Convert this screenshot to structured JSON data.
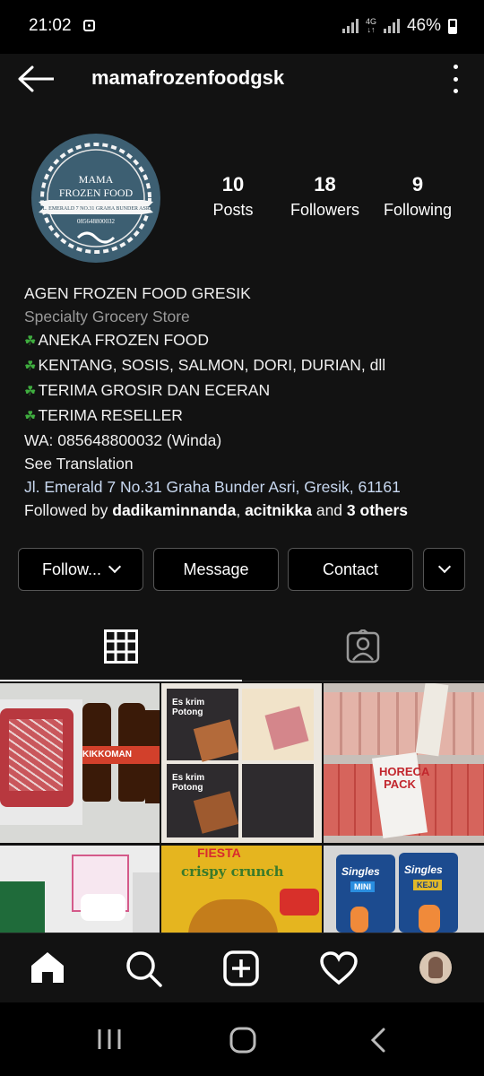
{
  "status": {
    "time": "21:02",
    "network": "4G",
    "battery": "46%"
  },
  "header": {
    "username": "mamafrozenfoodgsk"
  },
  "avatar": {
    "line1": "MAMA",
    "line2": "FROZEN FOOD",
    "ribbon": "JL. EMERALD 7 NO.31 GRAHA BUNDER ASRI",
    "phone": "085648800032"
  },
  "stats": [
    {
      "value": "10",
      "label": "Posts"
    },
    {
      "value": "18",
      "label": "Followers"
    },
    {
      "value": "9",
      "label": "Following"
    }
  ],
  "bio": {
    "name": "AGEN FROZEN FOOD GRESIK",
    "category": "Specialty Grocery Store",
    "lines": [
      "ANEKA FROZEN FOOD",
      "KENTANG, SOSIS, SALMON, DORI, DURIAN, dll",
      "TERIMA GROSIR DAN ECERAN",
      "TERIMA RESELLER"
    ],
    "contact": "WA: 085648800032 (Winda)",
    "translate": "See Translation",
    "address": "Jl. Emerald 7 No.31 Graha Bunder Asri, Gresik, 61161",
    "followed_prefix": "Followed by ",
    "followed_user1": "dadikaminnanda",
    "followed_sep": ", ",
    "followed_user2": "acitnikka",
    "followed_and": " and ",
    "followed_others": "3 others"
  },
  "buttons": {
    "following": "Follow...",
    "message": "Message",
    "contact": "Contact"
  },
  "grid_texts": {
    "kikkoman": "KIKKOMAN",
    "eskrim": "Es krim Potong",
    "horeca": "HORECA PACK",
    "crispy": "crispy crunch",
    "fiesta": "FIESTA",
    "singles": "Singles",
    "mini": "MINI",
    "keju": "KEJU"
  },
  "colors": {
    "background": "#121212",
    "avatar_bg": "#3d5f72",
    "clover": "#3fae3f",
    "address": "#c8d8f0"
  }
}
